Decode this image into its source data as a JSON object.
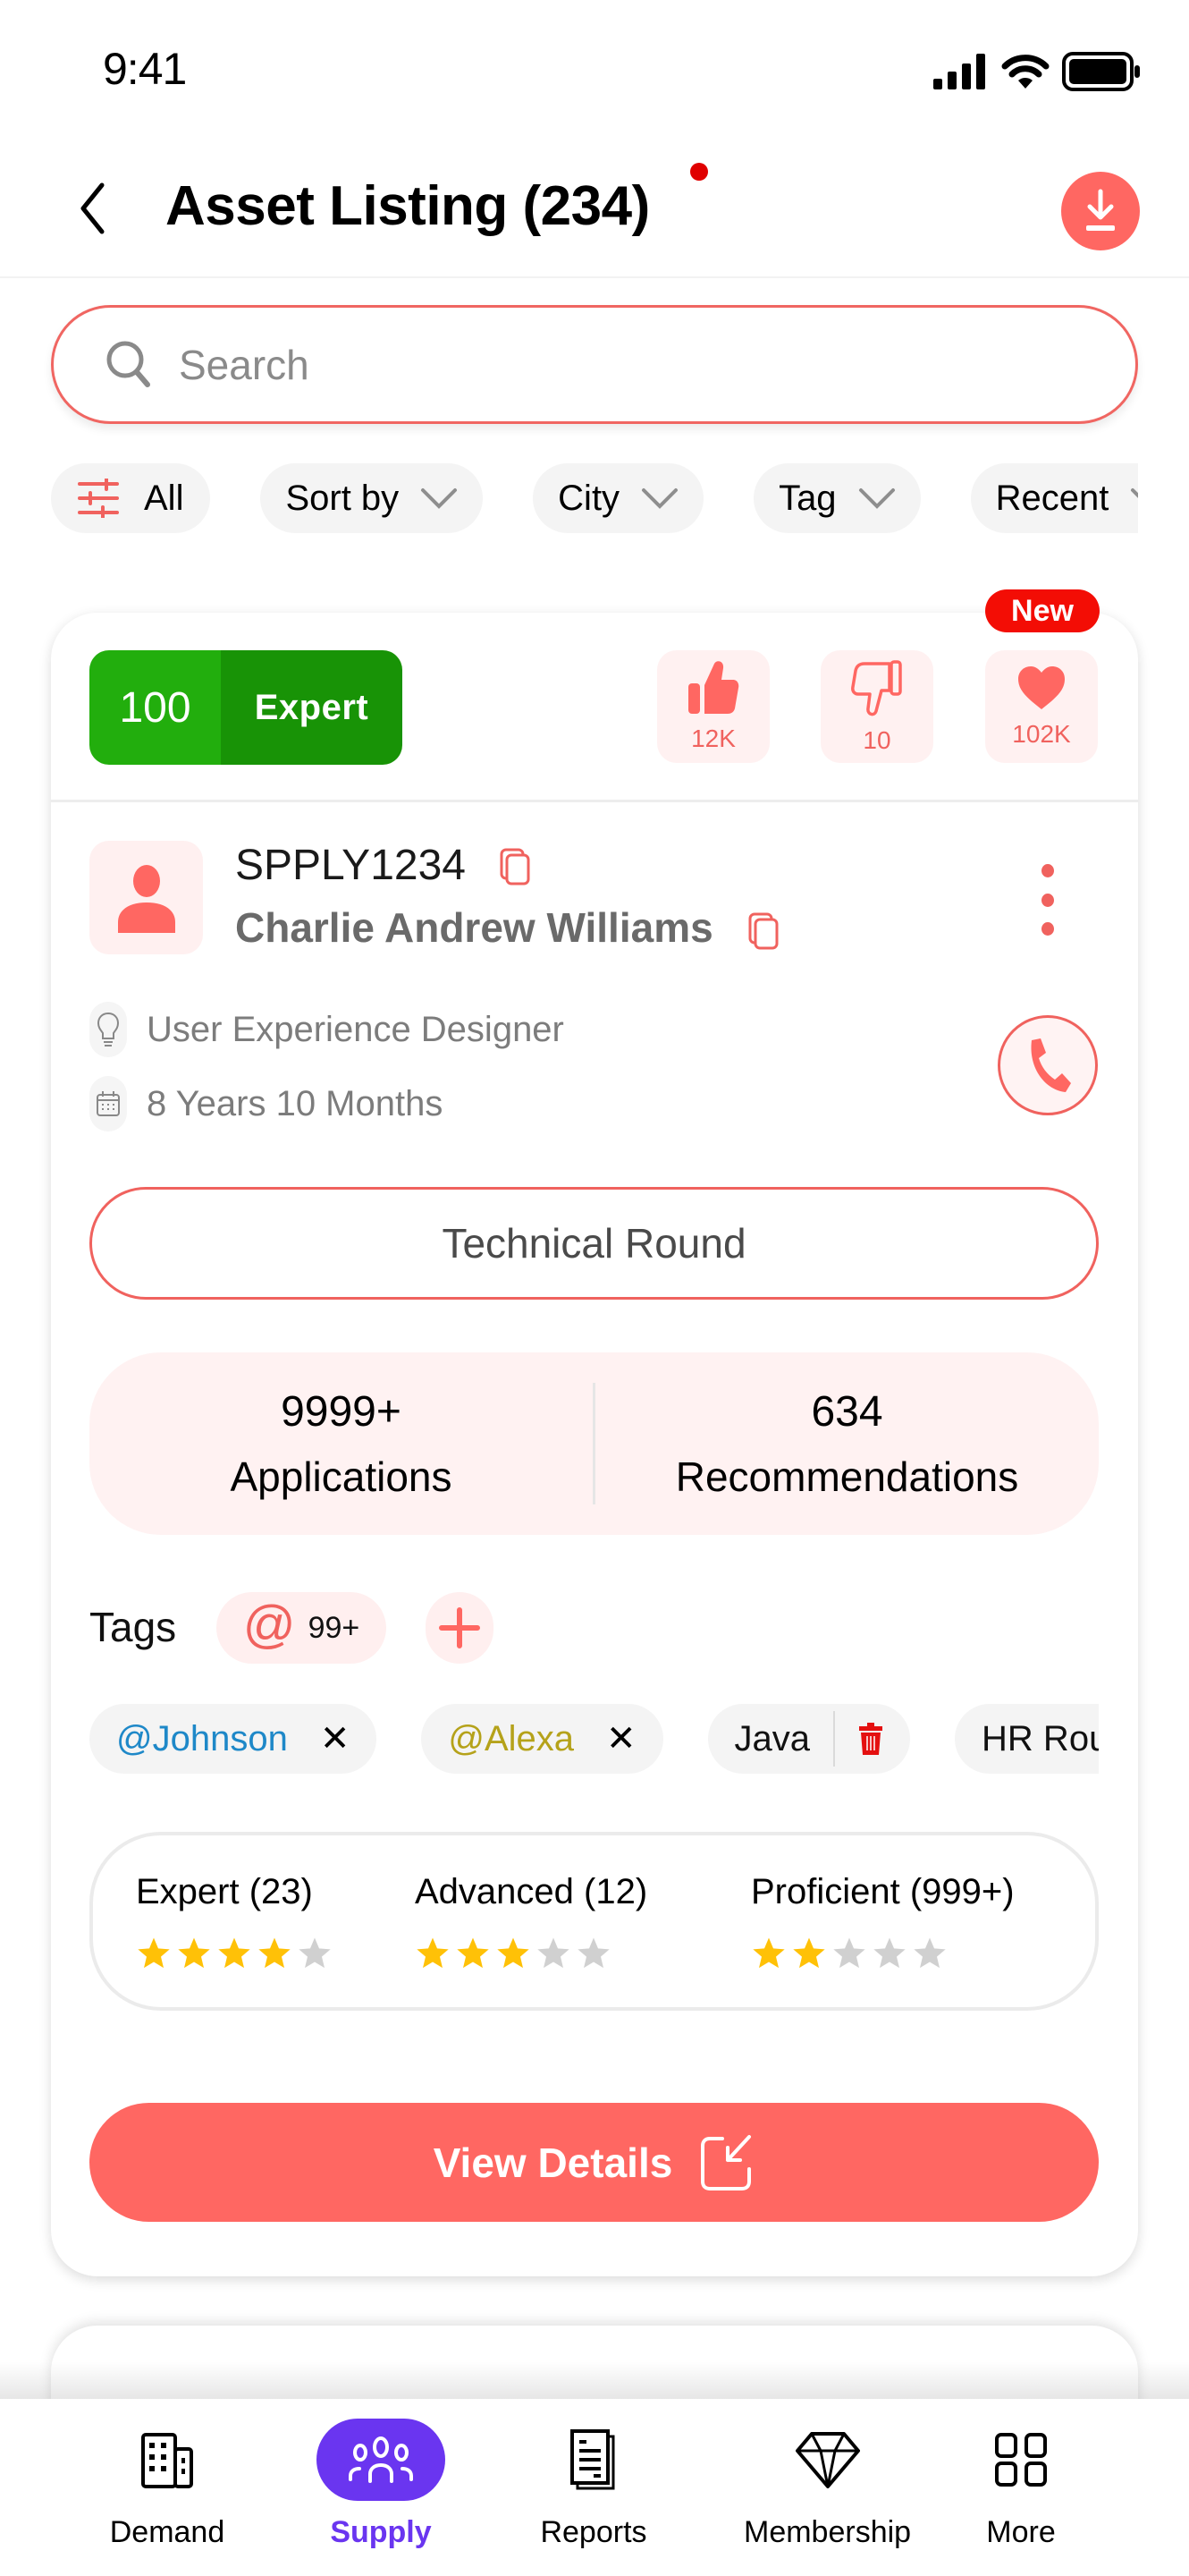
{
  "status_bar": {
    "time": "9:41"
  },
  "header": {
    "title": "Asset Listing (234)",
    "has_notification_dot": true
  },
  "search": {
    "placeholder": "Search",
    "value": ""
  },
  "filters": [
    {
      "label": "All",
      "icon": "sliders-icon"
    },
    {
      "label": "Sort by",
      "icon": "chevron-down-icon"
    },
    {
      "label": "City",
      "icon": "chevron-down-icon"
    },
    {
      "label": "Tag",
      "icon": "chevron-down-icon"
    },
    {
      "label": "Recent",
      "icon": "chevron-down-icon"
    }
  ],
  "card": {
    "score": "100",
    "level": "Expert",
    "new_badge": "New",
    "reactions": [
      {
        "name": "likes",
        "icon": "thumbs-up-icon",
        "count": "12K"
      },
      {
        "name": "dislikes",
        "icon": "thumbs-down-icon",
        "count": "10"
      },
      {
        "name": "favorites",
        "icon": "heart-icon",
        "count": "102K"
      }
    ],
    "asset_id": "SPPLY1234",
    "person_name": "Charlie Andrew Williams",
    "designation": "User Experience Designer",
    "experience": "8 Years 10 Months",
    "round": "Technical Round",
    "stats": [
      {
        "value": "9999+",
        "label": "Applications"
      },
      {
        "value": "634",
        "label": "Recommendations"
      }
    ],
    "tags_label": "Tags",
    "mentions_count": "99+",
    "tags": [
      {
        "label": "@Johnson",
        "color": "#1E88C8",
        "action": "remove"
      },
      {
        "label": "@Alexa",
        "color": "#B5A21A",
        "action": "remove"
      },
      {
        "label": "Java",
        "color": "#000000",
        "action": "delete"
      },
      {
        "label": "HR Round",
        "color": "#000000",
        "action": "none"
      }
    ],
    "ratings": [
      {
        "label": "Expert (23)",
        "stars": 4,
        "max": 5
      },
      {
        "label": "Advanced (12)",
        "stars": 3,
        "max": 5
      },
      {
        "label": "Proficient (999+)",
        "stars": 2,
        "max": 5
      }
    ],
    "view_details": "View Details"
  },
  "bottom_nav": [
    {
      "label": "Demand",
      "icon": "building-icon",
      "active": false
    },
    {
      "label": "Supply",
      "icon": "people-icon",
      "active": true
    },
    {
      "label": "Reports",
      "icon": "document-icon",
      "active": false
    },
    {
      "label": "Membership",
      "icon": "diamond-icon",
      "active": false
    },
    {
      "label": "More",
      "icon": "grid-icon",
      "active": false
    }
  ],
  "colors": {
    "accent": "#FF6762",
    "active_nav": "#6A35F0",
    "expert_green": "#22AE0D",
    "expert_green_dark": "#189306",
    "new_badge": "#F30D05",
    "star_filled": "#FFC107",
    "star_empty": "#D0D0D0"
  }
}
